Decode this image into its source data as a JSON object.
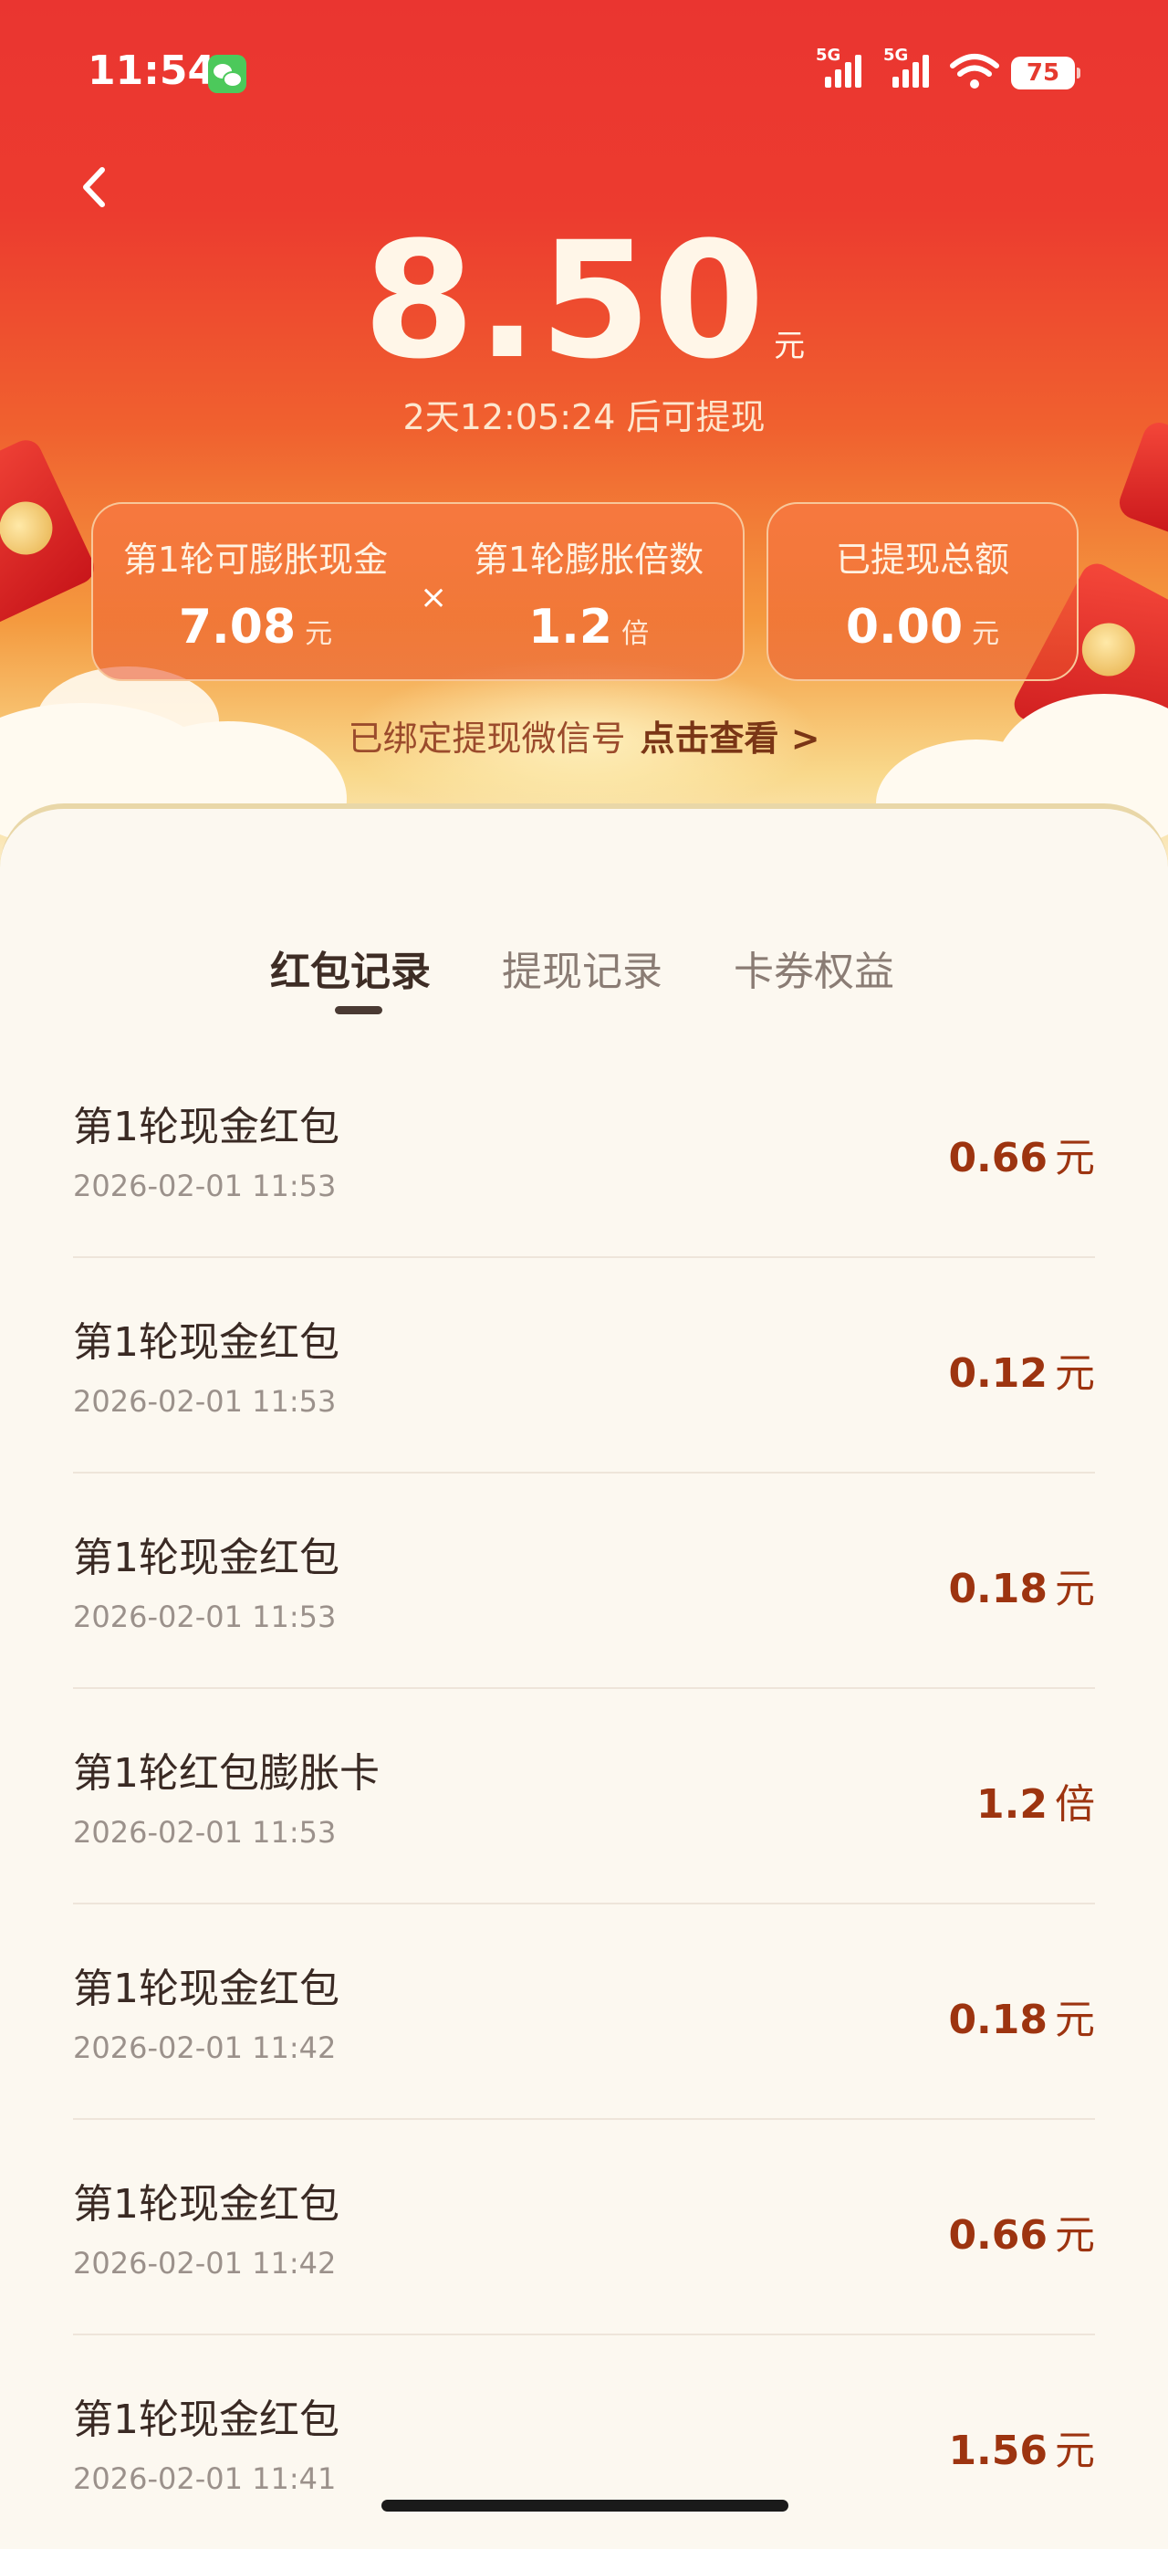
{
  "status_bar": {
    "time": "11:54",
    "network_labels": [
      "5G",
      "5G"
    ],
    "battery": "75"
  },
  "header": {
    "back_icon": "chevron-left-icon",
    "balance_amount": "8.50",
    "balance_unit": "元",
    "countdown": "2天12:05:24 后可提现"
  },
  "cards": {
    "expandable_label": "第1轮可膨胀现金",
    "expandable_value": "7.08",
    "expandable_unit": "元",
    "times_symbol": "×",
    "multiplier_label": "第1轮膨胀倍数",
    "multiplier_value": "1.2",
    "multiplier_unit": "倍",
    "withdrawn_label": "已提现总额",
    "withdrawn_value": "0.00",
    "withdrawn_unit": "元"
  },
  "wechat_bind": {
    "text": "已绑定提现微信号",
    "link": "点击查看 >"
  },
  "tabs": [
    {
      "label": "红包记录",
      "active": true
    },
    {
      "label": "提现记录",
      "active": false
    },
    {
      "label": "卡券权益",
      "active": false
    }
  ],
  "records": [
    {
      "title": "第1轮现金红包",
      "time": "2026-02-01 11:53",
      "amount": "0.66",
      "unit": "元"
    },
    {
      "title": "第1轮现金红包",
      "time": "2026-02-01 11:53",
      "amount": "0.12",
      "unit": "元"
    },
    {
      "title": "第1轮现金红包",
      "time": "2026-02-01 11:53",
      "amount": "0.18",
      "unit": "元"
    },
    {
      "title": "第1轮红包膨胀卡",
      "time": "2026-02-01 11:53",
      "amount": "1.2",
      "unit": "倍"
    },
    {
      "title": "第1轮现金红包",
      "time": "2026-02-01 11:42",
      "amount": "0.18",
      "unit": "元"
    },
    {
      "title": "第1轮现金红包",
      "time": "2026-02-01 11:42",
      "amount": "0.66",
      "unit": "元"
    },
    {
      "title": "第1轮现金红包",
      "time": "2026-02-01 11:41",
      "amount": "1.56",
      "unit": "元"
    }
  ],
  "colors": {
    "hero_top": "#ea3530",
    "hero_mid": "#f0612f",
    "hero_bottom": "#fbecc8",
    "amount_text": "#9d3410",
    "page_bg": "#fcf8f0"
  }
}
